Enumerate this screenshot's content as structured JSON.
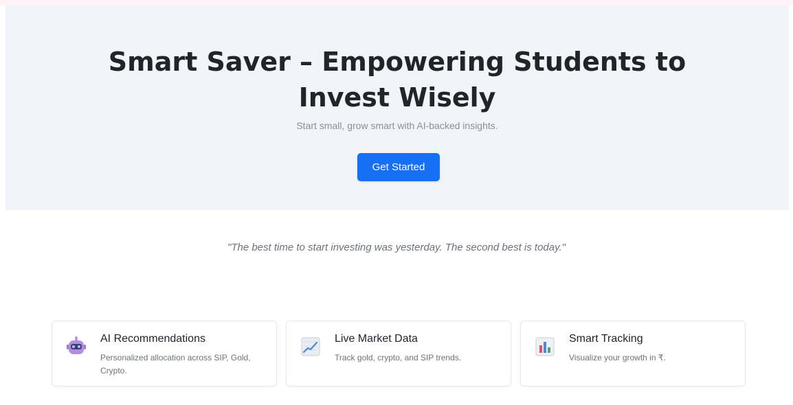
{
  "hero": {
    "title": "Smart Saver – Empowering Students to Invest Wisely",
    "subtitle": "Start small, grow smart with AI-backed insights.",
    "cta_label": "Get Started"
  },
  "quote": {
    "text": "\"The best time to start investing was yesterday. The second best is today.\""
  },
  "features": [
    {
      "icon": "robot-icon",
      "title": "AI Recommendations",
      "text": "Personalized allocation across SIP, Gold, Crypto."
    },
    {
      "icon": "chart-increasing-icon",
      "title": "Live Market Data",
      "text": "Track gold, crypto, and SIP trends."
    },
    {
      "icon": "bar-chart-icon",
      "title": "Smart Tracking",
      "text": "Visualize your growth in ₹."
    }
  ],
  "colors": {
    "accent": "#1670f5",
    "hero_background": "#f1f4f8",
    "heading": "#212529",
    "muted_text": "#6c727a"
  }
}
